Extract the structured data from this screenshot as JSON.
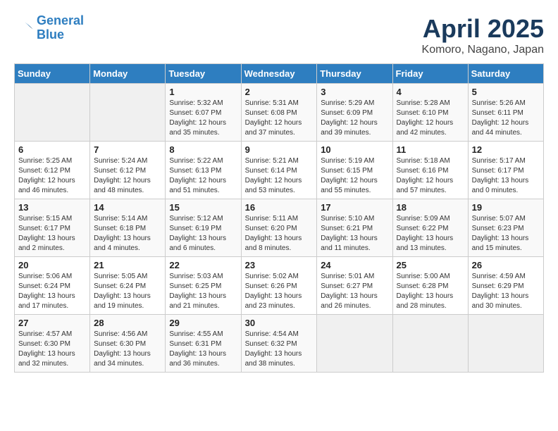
{
  "logo": {
    "line1": "General",
    "line2": "Blue"
  },
  "title": "April 2025",
  "subtitle": "Komoro, Nagano, Japan",
  "weekdays": [
    "Sunday",
    "Monday",
    "Tuesday",
    "Wednesday",
    "Thursday",
    "Friday",
    "Saturday"
  ],
  "weeks": [
    [
      {
        "day": "",
        "info": ""
      },
      {
        "day": "",
        "info": ""
      },
      {
        "day": "1",
        "info": "Sunrise: 5:32 AM\nSunset: 6:07 PM\nDaylight: 12 hours and 35 minutes."
      },
      {
        "day": "2",
        "info": "Sunrise: 5:31 AM\nSunset: 6:08 PM\nDaylight: 12 hours and 37 minutes."
      },
      {
        "day": "3",
        "info": "Sunrise: 5:29 AM\nSunset: 6:09 PM\nDaylight: 12 hours and 39 minutes."
      },
      {
        "day": "4",
        "info": "Sunrise: 5:28 AM\nSunset: 6:10 PM\nDaylight: 12 hours and 42 minutes."
      },
      {
        "day": "5",
        "info": "Sunrise: 5:26 AM\nSunset: 6:11 PM\nDaylight: 12 hours and 44 minutes."
      }
    ],
    [
      {
        "day": "6",
        "info": "Sunrise: 5:25 AM\nSunset: 6:12 PM\nDaylight: 12 hours and 46 minutes."
      },
      {
        "day": "7",
        "info": "Sunrise: 5:24 AM\nSunset: 6:12 PM\nDaylight: 12 hours and 48 minutes."
      },
      {
        "day": "8",
        "info": "Sunrise: 5:22 AM\nSunset: 6:13 PM\nDaylight: 12 hours and 51 minutes."
      },
      {
        "day": "9",
        "info": "Sunrise: 5:21 AM\nSunset: 6:14 PM\nDaylight: 12 hours and 53 minutes."
      },
      {
        "day": "10",
        "info": "Sunrise: 5:19 AM\nSunset: 6:15 PM\nDaylight: 12 hours and 55 minutes."
      },
      {
        "day": "11",
        "info": "Sunrise: 5:18 AM\nSunset: 6:16 PM\nDaylight: 12 hours and 57 minutes."
      },
      {
        "day": "12",
        "info": "Sunrise: 5:17 AM\nSunset: 6:17 PM\nDaylight: 13 hours and 0 minutes."
      }
    ],
    [
      {
        "day": "13",
        "info": "Sunrise: 5:15 AM\nSunset: 6:17 PM\nDaylight: 13 hours and 2 minutes."
      },
      {
        "day": "14",
        "info": "Sunrise: 5:14 AM\nSunset: 6:18 PM\nDaylight: 13 hours and 4 minutes."
      },
      {
        "day": "15",
        "info": "Sunrise: 5:12 AM\nSunset: 6:19 PM\nDaylight: 13 hours and 6 minutes."
      },
      {
        "day": "16",
        "info": "Sunrise: 5:11 AM\nSunset: 6:20 PM\nDaylight: 13 hours and 8 minutes."
      },
      {
        "day": "17",
        "info": "Sunrise: 5:10 AM\nSunset: 6:21 PM\nDaylight: 13 hours and 11 minutes."
      },
      {
        "day": "18",
        "info": "Sunrise: 5:09 AM\nSunset: 6:22 PM\nDaylight: 13 hours and 13 minutes."
      },
      {
        "day": "19",
        "info": "Sunrise: 5:07 AM\nSunset: 6:23 PM\nDaylight: 13 hours and 15 minutes."
      }
    ],
    [
      {
        "day": "20",
        "info": "Sunrise: 5:06 AM\nSunset: 6:24 PM\nDaylight: 13 hours and 17 minutes."
      },
      {
        "day": "21",
        "info": "Sunrise: 5:05 AM\nSunset: 6:24 PM\nDaylight: 13 hours and 19 minutes."
      },
      {
        "day": "22",
        "info": "Sunrise: 5:03 AM\nSunset: 6:25 PM\nDaylight: 13 hours and 21 minutes."
      },
      {
        "day": "23",
        "info": "Sunrise: 5:02 AM\nSunset: 6:26 PM\nDaylight: 13 hours and 23 minutes."
      },
      {
        "day": "24",
        "info": "Sunrise: 5:01 AM\nSunset: 6:27 PM\nDaylight: 13 hours and 26 minutes."
      },
      {
        "day": "25",
        "info": "Sunrise: 5:00 AM\nSunset: 6:28 PM\nDaylight: 13 hours and 28 minutes."
      },
      {
        "day": "26",
        "info": "Sunrise: 4:59 AM\nSunset: 6:29 PM\nDaylight: 13 hours and 30 minutes."
      }
    ],
    [
      {
        "day": "27",
        "info": "Sunrise: 4:57 AM\nSunset: 6:30 PM\nDaylight: 13 hours and 32 minutes."
      },
      {
        "day": "28",
        "info": "Sunrise: 4:56 AM\nSunset: 6:30 PM\nDaylight: 13 hours and 34 minutes."
      },
      {
        "day": "29",
        "info": "Sunrise: 4:55 AM\nSunset: 6:31 PM\nDaylight: 13 hours and 36 minutes."
      },
      {
        "day": "30",
        "info": "Sunrise: 4:54 AM\nSunset: 6:32 PM\nDaylight: 13 hours and 38 minutes."
      },
      {
        "day": "",
        "info": ""
      },
      {
        "day": "",
        "info": ""
      },
      {
        "day": "",
        "info": ""
      }
    ]
  ]
}
